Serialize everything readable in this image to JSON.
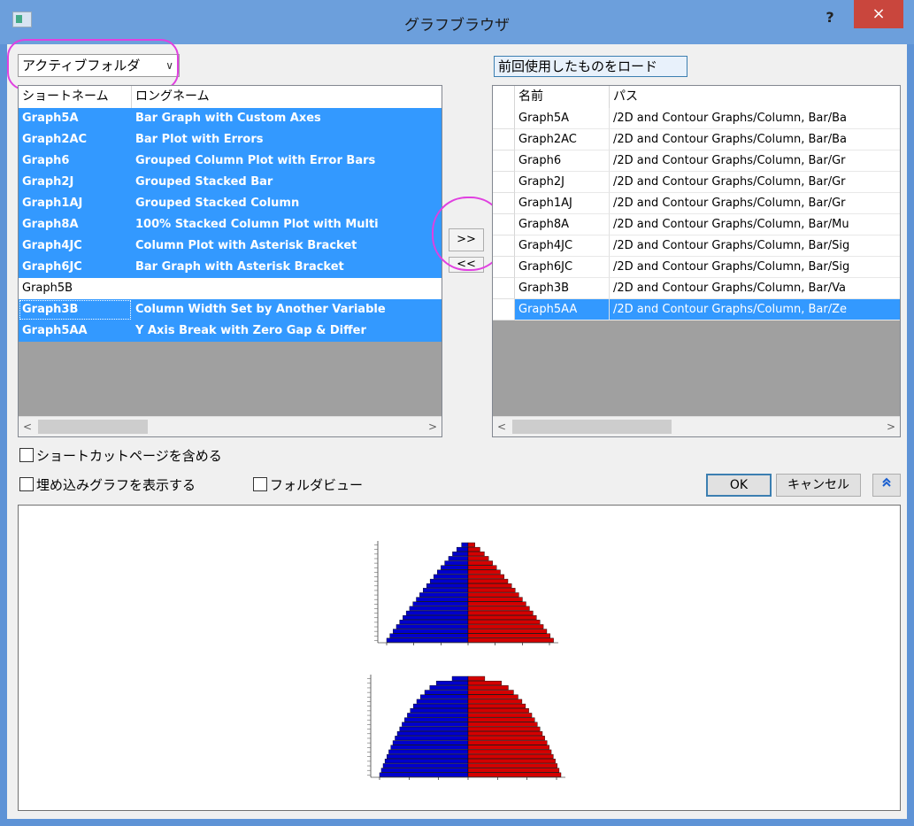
{
  "window": {
    "title": "グラフブラウザ",
    "help": "?",
    "close": "×"
  },
  "source_combo": {
    "value": "アクティブフォルダ",
    "arrow": "∨"
  },
  "load_button": "前回使用したものをロード",
  "left_list": {
    "headers": [
      "ショートネーム",
      "ロングネーム"
    ],
    "rows": [
      {
        "short": "Graph5A",
        "long": "Bar Graph with Custom Axes",
        "selected": true
      },
      {
        "short": "Graph2AC",
        "long": "Bar Plot with Errors",
        "selected": true
      },
      {
        "short": "Graph6",
        "long": "Grouped Column Plot with Error Bars",
        "selected": true
      },
      {
        "short": "Graph2J",
        "long": "Grouped Stacked Bar",
        "selected": true
      },
      {
        "short": "Graph1AJ",
        "long": "Grouped Stacked Column",
        "selected": true
      },
      {
        "short": "Graph8A",
        "long": "100% Stacked Column Plot with Multi",
        "selected": true
      },
      {
        "short": "Graph4JC",
        "long": "Column Plot with Asterisk Bracket",
        "selected": true
      },
      {
        "short": "Graph6JC",
        "long": "Bar Graph with Asterisk Bracket",
        "selected": true
      },
      {
        "short": "Graph5B",
        "long": "",
        "selected": false
      },
      {
        "short": "Graph3B",
        "long": "Column Width Set by Another Variable",
        "selected": true
      },
      {
        "short": "Graph5AA",
        "long": "Y Axis Break with Zero Gap & Differ",
        "selected": true
      }
    ]
  },
  "move_buttons": {
    "add": ">>",
    "remove": "<<"
  },
  "right_list": {
    "headers": [
      "名前",
      "パス"
    ],
    "rows": [
      {
        "name": "Graph5A",
        "path": "/2D and Contour Graphs/Column, Bar/Ba",
        "selected": false
      },
      {
        "name": "Graph2AC",
        "path": "/2D and Contour Graphs/Column, Bar/Ba",
        "selected": false
      },
      {
        "name": "Graph6",
        "path": "/2D and Contour Graphs/Column, Bar/Gr",
        "selected": false
      },
      {
        "name": "Graph2J",
        "path": "/2D and Contour Graphs/Column, Bar/Gr",
        "selected": false
      },
      {
        "name": "Graph1AJ",
        "path": "/2D and Contour Graphs/Column, Bar/Gr",
        "selected": false
      },
      {
        "name": "Graph8A",
        "path": "/2D and Contour Graphs/Column, Bar/Mu",
        "selected": false
      },
      {
        "name": "Graph4JC",
        "path": "/2D and Contour Graphs/Column, Bar/Sig",
        "selected": false
      },
      {
        "name": "Graph6JC",
        "path": "/2D and Contour Graphs/Column, Bar/Sig",
        "selected": false
      },
      {
        "name": "Graph3B",
        "path": "/2D and Contour Graphs/Column, Bar/Va",
        "selected": false
      },
      {
        "name": "Graph5AA",
        "path": "/2D and Contour Graphs/Column, Bar/Ze",
        "selected": true
      }
    ]
  },
  "options": {
    "include_shortcut": "ショートカットページを含める",
    "show_embedded": "埋め込みグラフを表示する",
    "folder_view": "フォルダビュー"
  },
  "buttons": {
    "ok": "OK",
    "cancel": "キャンセル",
    "collapse": "≈"
  },
  "colors": {
    "selection": "#3399ff",
    "male": "#0000cc",
    "female": "#d40000",
    "annotation": "#e040e0"
  }
}
